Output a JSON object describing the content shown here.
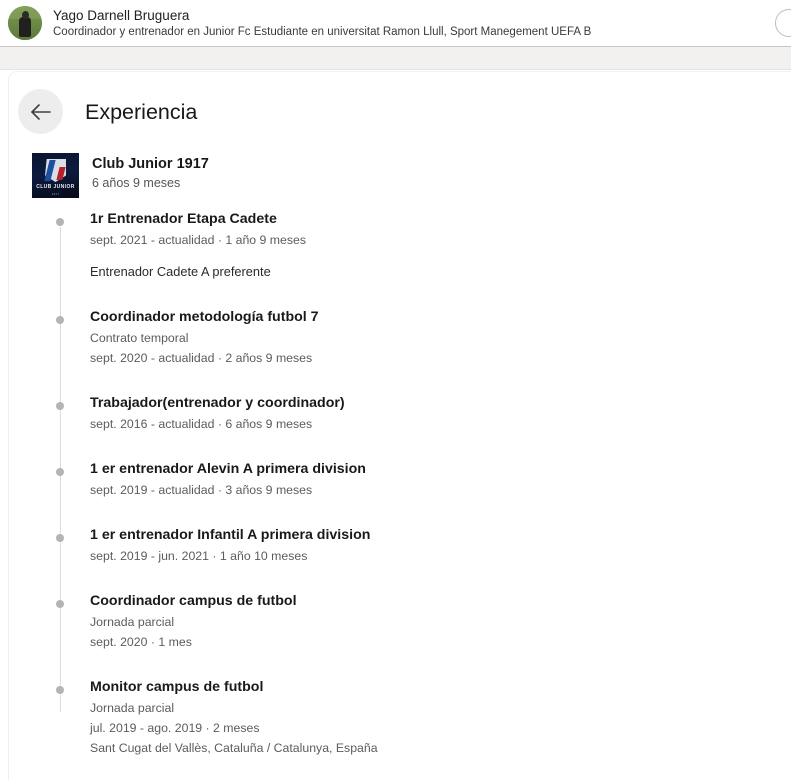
{
  "profile": {
    "name": "Yago Darnell Bruguera",
    "headline": "Coordinador y entrenador en Junior Fc Estudiante en universitat Ramon Llull, Sport Manegement UEFA B",
    "avatar_icon": "profile-photo"
  },
  "header": {
    "action_icon": "circle-action-icon"
  },
  "page": {
    "back_icon": "arrow-left-icon",
    "title": "Experiencia"
  },
  "company": {
    "logo_word": "CLUB JUNIOR",
    "logo_sub": "1917",
    "name": "Club Junior 1917",
    "duration": "6 años 9 meses"
  },
  "entries": [
    {
      "title": "1r Entrenador Etapa Cadete",
      "employment_type": "",
      "dates": "sept. 2021 - actualidad · 1 año 9 meses",
      "location": "",
      "description": "Entrenador Cadete A preferente"
    },
    {
      "title": "Coordinador metodología futbol 7",
      "employment_type": "Contrato temporal",
      "dates": "sept. 2020 - actualidad · 2 años 9 meses",
      "location": "",
      "description": ""
    },
    {
      "title": "Trabajador(entrenador y coordinador)",
      "employment_type": "",
      "dates": "sept. 2016 - actualidad · 6 años 9 meses",
      "location": "",
      "description": ""
    },
    {
      "title": "1 er entrenador Alevin A primera division",
      "employment_type": "",
      "dates": "sept. 2019 - actualidad · 3 años 9 meses",
      "location": "",
      "description": ""
    },
    {
      "title": "1 er entrenador Infantil A primera division",
      "employment_type": "",
      "dates": "sept. 2019 - jun. 2021 · 1 año 10 meses",
      "location": "",
      "description": ""
    },
    {
      "title": "Coordinador campus de futbol",
      "employment_type": "Jornada parcial",
      "dates": "sept. 2020 · 1 mes",
      "location": "",
      "description": ""
    },
    {
      "title": "Monitor campus de futbol",
      "employment_type": "Jornada parcial",
      "dates": "jul. 2019 - ago. 2019 · 2 meses",
      "location": "Sant Cugat del Vallès, Cataluña / Catalunya, España",
      "description": ""
    }
  ],
  "colors": {
    "text_primary": "#191919",
    "text_secondary": "#5c5c5c",
    "timeline_dot": "#b4b4b4",
    "band": "#f2f1f0",
    "back_button_bg": "#ededed"
  }
}
